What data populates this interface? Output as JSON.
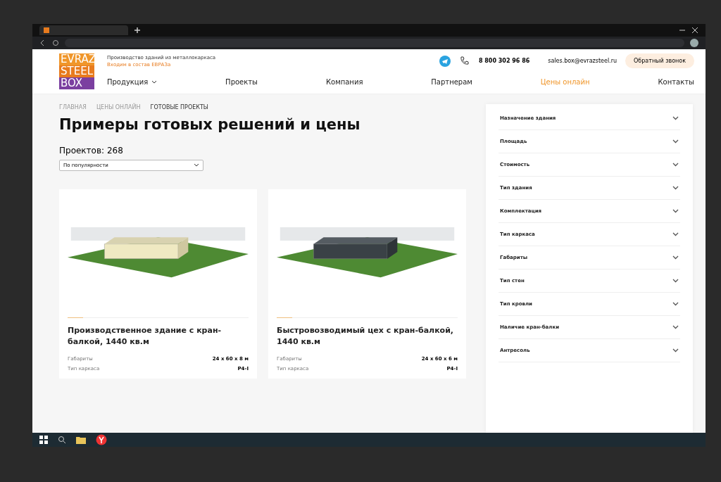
{
  "logo": {
    "lines": [
      {
        "text": "EVRAZ",
        "color": "#f0962a"
      },
      {
        "text": "STEEL",
        "color": "#e87b1e"
      },
      {
        "text": "BOX",
        "color": "#7b3fa0"
      }
    ]
  },
  "header": {
    "tagline": "Производство зданий из металлокаркаса",
    "subtagline": "Входим в состав ЕВРАЗа",
    "phone": "8 800 302 96 86",
    "email": "sales.box@evrazsteel.ru",
    "callback_button": "Обратный звонок"
  },
  "nav": [
    {
      "label": "Продукция",
      "dropdown": true,
      "selected": false
    },
    {
      "label": "Проекты",
      "dropdown": false,
      "selected": false
    },
    {
      "label": "Компания",
      "dropdown": false,
      "selected": false
    },
    {
      "label": "Партнерам",
      "dropdown": false,
      "selected": false
    },
    {
      "label": "Цены онлайн",
      "dropdown": false,
      "selected": true
    },
    {
      "label": "Контакты",
      "dropdown": false,
      "selected": false
    }
  ],
  "breadcrumbs": [
    "ГЛАВНАЯ",
    "ЦЕНЫ ОНЛАЙН",
    "ГОТОВЫЕ ПРОЕКТЫ"
  ],
  "title": "Примеры готовых решений и цены",
  "count": "Проектов: 268",
  "sort": {
    "value": "По популярности"
  },
  "cards": [
    {
      "title": "Производственное здание с кран-балкой, 1440 кв.м",
      "kind": "light",
      "specs": [
        {
          "label": "Габариты",
          "value": "24 x 60 x 8 м"
        },
        {
          "label": "Тип каркаса",
          "value": "Р4-I"
        }
      ]
    },
    {
      "title": "Быстровозводимый цех с кран-балкой, 1440 кв.м",
      "kind": "dark",
      "specs": [
        {
          "label": "Габариты",
          "value": "24 x 60 x 6 м"
        },
        {
          "label": "Тип каркаса",
          "value": "Р4-I"
        }
      ]
    }
  ],
  "filters": [
    {
      "label": "Назначение здания",
      "expanded": false
    },
    {
      "label": "Площадь",
      "expanded": false
    },
    {
      "label": "Стоимость",
      "expanded": false
    },
    {
      "label": "Тип здания",
      "expanded": false
    },
    {
      "label": "Комплектация",
      "expanded": false
    },
    {
      "label": "Тип каркаса",
      "expanded": false
    },
    {
      "label": "Габариты",
      "expanded": false
    },
    {
      "label": "Тип стен",
      "expanded": false
    },
    {
      "label": "Тип кровли",
      "expanded": false
    },
    {
      "label": "Наличие кран-балки",
      "expanded": false
    },
    {
      "label": "Антресоль",
      "expanded": false
    }
  ]
}
